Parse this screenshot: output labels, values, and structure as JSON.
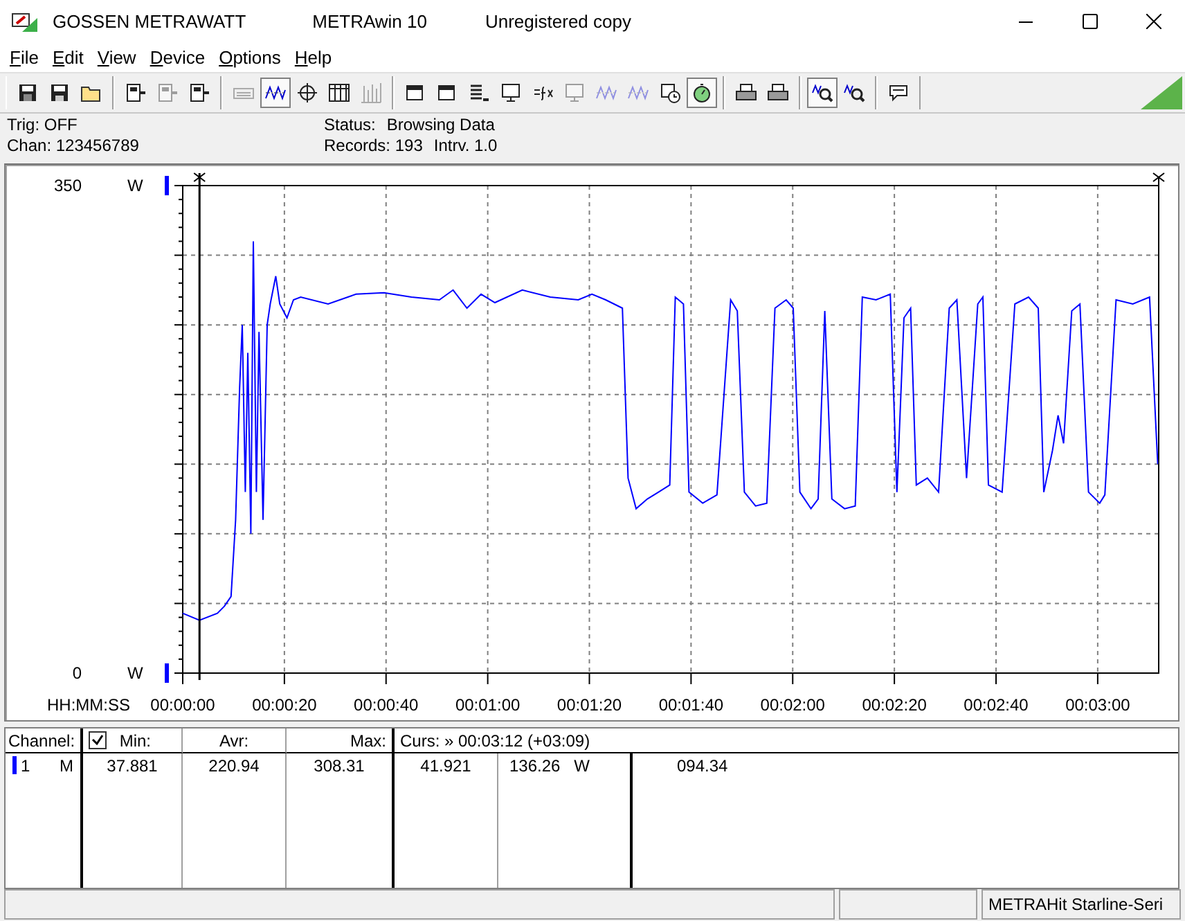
{
  "window": {
    "titles": [
      "GOSSEN METRAWATT",
      "METRAwin 10",
      "Unregistered copy"
    ]
  },
  "menu": [
    {
      "label": "File"
    },
    {
      "label": "Edit"
    },
    {
      "label": "View"
    },
    {
      "label": "Device"
    },
    {
      "label": "Options"
    },
    {
      "label": "Help"
    }
  ],
  "toolbar": [
    [
      {
        "kind": "save",
        "disabled": false,
        "pressed": false
      },
      {
        "kind": "saveas",
        "disabled": false,
        "pressed": false
      },
      {
        "kind": "open",
        "disabled": false,
        "pressed": false
      }
    ],
    [
      {
        "kind": "device",
        "disabled": false,
        "pressed": false
      },
      {
        "kind": "device",
        "disabled": true,
        "pressed": false
      },
      {
        "kind": "device",
        "disabled": false,
        "pressed": false
      }
    ],
    [
      {
        "kind": "keyboard",
        "disabled": true,
        "pressed": false
      },
      {
        "kind": "wave",
        "disabled": false,
        "pressed": true
      },
      {
        "kind": "crosshair",
        "disabled": false,
        "pressed": false
      },
      {
        "kind": "table",
        "disabled": false,
        "pressed": false
      },
      {
        "kind": "bars",
        "disabled": true,
        "pressed": false
      }
    ],
    [
      {
        "kind": "window",
        "disabled": false,
        "pressed": false
      },
      {
        "kind": "window",
        "disabled": false,
        "pressed": false
      },
      {
        "kind": "list",
        "disabled": false,
        "pressed": false
      },
      {
        "kind": "monitor",
        "disabled": false,
        "pressed": false
      },
      {
        "kind": "formula",
        "disabled": false,
        "pressed": false
      },
      {
        "kind": "monitor",
        "disabled": true,
        "pressed": false
      },
      {
        "kind": "wave",
        "disabled": true,
        "pressed": false
      },
      {
        "kind": "wave",
        "disabled": true,
        "pressed": false
      },
      {
        "kind": "clock",
        "disabled": false,
        "pressed": false
      },
      {
        "kind": "stopwatch",
        "disabled": false,
        "pressed": true
      }
    ],
    [
      {
        "kind": "printer",
        "disabled": false,
        "pressed": false
      },
      {
        "kind": "printer",
        "disabled": false,
        "pressed": false
      }
    ],
    [
      {
        "kind": "zoom",
        "disabled": false,
        "pressed": true
      },
      {
        "kind": "zoom",
        "disabled": false,
        "pressed": false
      }
    ],
    [
      {
        "kind": "comment",
        "disabled": false,
        "pressed": false
      }
    ]
  ],
  "info": {
    "left": [
      "Trig: OFF",
      "Chan:  123456789"
    ],
    "right": [
      {
        "label": "Status:",
        "value": "Browsing Data"
      },
      {
        "label": "Records: 193",
        "value": "Intrv. 1.0"
      }
    ]
  },
  "chart": {
    "units": [
      "W",
      "W"
    ],
    "chart_data": {
      "type": "line",
      "grid": true,
      "ref_lines": [
        {
          "axis": "x",
          "value": 3.3
        }
      ],
      "xlabel": "HH:MM:SS",
      "xlim": [
        0,
        192
      ],
      "ylim": [
        0,
        350
      ],
      "yticks": [
        {
          "value": 350,
          "label": "350"
        },
        {
          "value": 0,
          "label": "0"
        }
      ],
      "xticks": [
        {
          "value": 0,
          "label": "00:00:00"
        },
        {
          "value": 20,
          "label": "00:00:20"
        },
        {
          "value": 40,
          "label": "00:00:40"
        },
        {
          "value": 60,
          "label": "00:01:00"
        },
        {
          "value": 80,
          "label": "00:01:20"
        },
        {
          "value": 100,
          "label": "00:01:40"
        },
        {
          "value": 120,
          "label": "00:02:00"
        },
        {
          "value": 140,
          "label": "00:02:20"
        },
        {
          "value": 160,
          "label": "00:02:40"
        },
        {
          "value": 180,
          "label": "00:03:00"
        }
      ],
      "x": [
        0,
        3.3,
        6.8,
        8.2,
        9.5,
        10.4,
        11.2,
        11.7,
        12.3,
        12.8,
        13.4,
        13.9,
        14.5,
        15.0,
        15.8,
        16.6,
        17.2,
        18.3,
        19.1,
        20.5,
        21.8,
        23.2,
        28.6,
        34.1,
        39.6,
        45.0,
        50.5,
        53.2,
        55.9,
        58.7,
        61.4,
        66.8,
        72.3,
        77.8,
        80.5,
        83.2,
        86.5,
        87.6,
        89.2,
        91.4,
        93.6,
        95.8,
        96.9,
        98.5,
        99.6,
        102.3,
        105.1,
        107.8,
        109.1,
        110.5,
        112.7,
        114.9,
        116.5,
        118.7,
        120.1,
        121.4,
        123.6,
        125.0,
        126.3,
        127.7,
        130.2,
        132.3,
        133.7,
        136.4,
        139.2,
        140.5,
        141.9,
        143.2,
        144.3,
        146.5,
        148.7,
        150.8,
        152.3,
        154.2,
        156.4,
        157.4,
        158.5,
        161.2,
        163.7,
        166.4,
        168.3,
        169.4,
        171.1,
        172.2,
        173.3,
        174.9,
        176.5,
        178.2,
        180.4,
        181.4,
        183.6,
        186.9,
        190.2,
        191.8
      ],
      "series": [
        {
          "color": "#0000ff",
          "values": [
            43,
            38,
            43,
            48,
            55,
            110,
            205,
            250,
            130,
            230,
            100,
            310,
            130,
            245,
            110,
            250,
            265,
            285,
            265,
            255,
            268,
            270,
            265,
            272,
            273,
            270,
            268,
            275,
            262,
            272,
            266,
            275,
            270,
            268,
            272,
            268,
            262,
            140,
            118,
            125,
            130,
            135,
            270,
            265,
            130,
            122,
            128,
            268,
            260,
            130,
            120,
            122,
            262,
            268,
            262,
            130,
            118,
            125,
            260,
            125,
            118,
            120,
            270,
            268,
            272,
            130,
            255,
            262,
            135,
            140,
            130,
            262,
            268,
            140,
            265,
            270,
            135,
            130,
            265,
            270,
            262,
            130,
            160,
            185,
            165,
            260,
            265,
            130,
            122,
            128,
            268,
            265,
            270,
            150
          ]
        }
      ]
    }
  },
  "table": {
    "all_checked": true,
    "header": [
      "Channel:",
      "Min:",
      "Avr:",
      "Max:",
      "Curs: » 00:03:12 (+03:09)"
    ],
    "rows": [
      {
        "color": "#0000ff",
        "cells": [
          "1",
          "M",
          "37.881",
          "220.94",
          "308.31",
          "41.921",
          "136.26",
          "W",
          "094.34"
        ]
      }
    ]
  },
  "status_bar": [
    "METRAHit Starline-Seri"
  ]
}
